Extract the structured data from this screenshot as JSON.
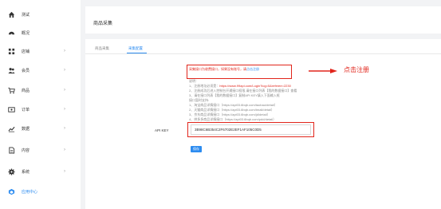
{
  "sidebar": {
    "items": [
      {
        "label": "测试",
        "icon": "home-icon",
        "chevron": ""
      },
      {
        "label": "概况",
        "icon": "dashboard-icon",
        "chevron": ""
      },
      {
        "label": "店铺",
        "icon": "grid-icon",
        "chevron": "›"
      },
      {
        "label": "会员",
        "icon": "users-icon",
        "chevron": "›"
      },
      {
        "label": "商品",
        "icon": "cart-icon",
        "chevron": "›"
      },
      {
        "label": "订单",
        "icon": "card-icon",
        "chevron": "›"
      },
      {
        "label": "数据",
        "icon": "chart-icon",
        "chevron": "›"
      },
      {
        "label": "内容",
        "icon": "document-icon",
        "chevron": "›"
      },
      {
        "label": "系统",
        "icon": "gear-icon",
        "chevron": "›"
      },
      {
        "label": "应用中心",
        "icon": "app-icon",
        "chevron": ""
      }
    ]
  },
  "header": {
    "title": "商品采集"
  },
  "tabs": [
    {
      "label": "商品采集"
    },
    {
      "label": "采集配置"
    }
  ],
  "notice": {
    "text": "采集接口为收费接口，如果没有账号，请",
    "link": "点击注册"
  },
  "callout": "点击注册",
  "instructions": {
    "heading": "说明：",
    "line1_prefix": "1、注册地址必须是：",
    "line1_url": "https://www.99api.com/Login?log=5&referee=2230",
    "line2": "2、注册成功后进入控制台开通接口权限,请在接口列表【我的数据接口】查看",
    "line3": "3、请在接口列表【我的数据接口】复制API KEY填入下面输入框",
    "support": "接口暂时支持:",
    "s1": "1、淘宝商品详情接口（https://api03.6bqb.com/taobao/detail）",
    "s2": "2、天猫商品详情接口（https://api03.6bqb.com/tmall/detail）",
    "s3": "3、京东商品详情接口（https://api03.6bqb.com/jd/detail）",
    "s4": "4、拼多多商品详情接口（https://api03.6bqb.com/pdd/detail）"
  },
  "api": {
    "label": "API KEY",
    "value": "3B98C6B354C2F6702E2EF1AF105C0D5"
  },
  "save_label": "保存",
  "colors": {
    "accent": "#2d8cf0",
    "annotation": "#e1251b"
  }
}
